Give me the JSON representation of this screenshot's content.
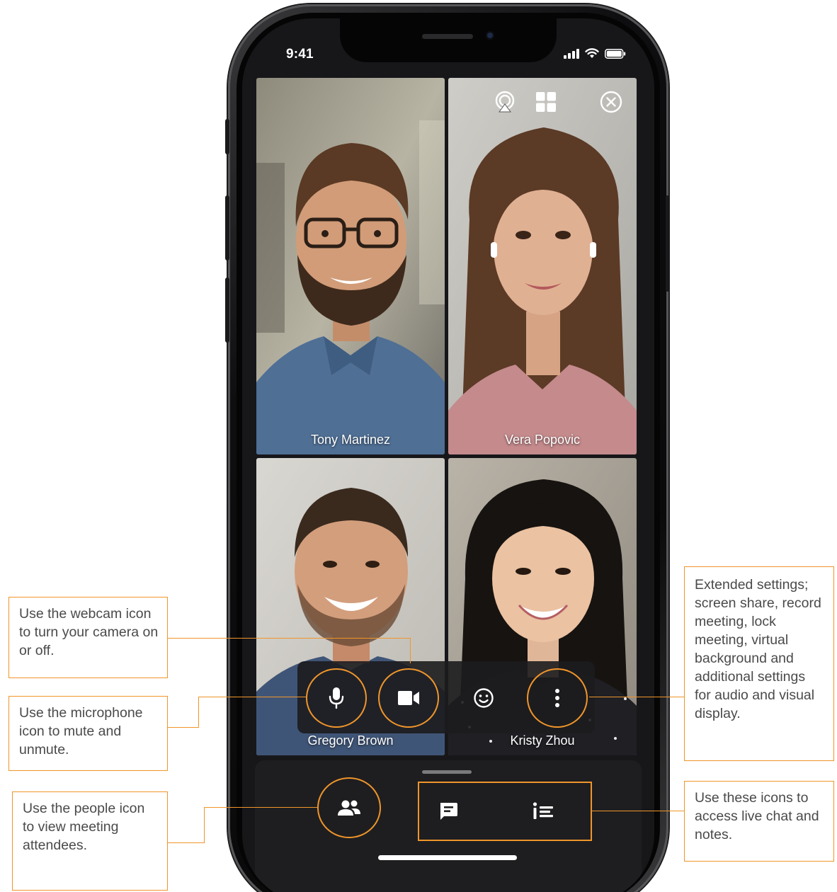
{
  "status_bar": {
    "time": "9:41"
  },
  "participants": [
    {
      "name": "Tony Martinez"
    },
    {
      "name": "Vera Popovic"
    },
    {
      "name": "Gregory Brown"
    },
    {
      "name": "Kristy Zhou"
    }
  ],
  "top_controls": [
    "airplay-icon",
    "grid-layout-icon",
    "close-circle-icon"
  ],
  "toolbar": {
    "buttons": [
      "microphone-icon",
      "webcam-icon",
      "emoji-icon",
      "more-vertical-icon"
    ]
  },
  "bottom_bar": {
    "buttons": [
      "people-icon",
      "chat-icon",
      "notes-icon"
    ]
  },
  "callouts": {
    "webcam": "Use the webcam icon to turn your camera on or off.",
    "microphone": "Use the microphone icon to mute and unmute.",
    "people": "Use the people icon to view meeting attendees.",
    "settings": "Extended settings; screen share, record meeting, lock meeting, virtual background and additional settings for audio and visual display.",
    "chat_notes": "Use these icons to access live chat and notes."
  },
  "colors": {
    "accent": "#f0952a",
    "callout_text": "#4a4a4a",
    "screen_bg": "#17171a"
  }
}
